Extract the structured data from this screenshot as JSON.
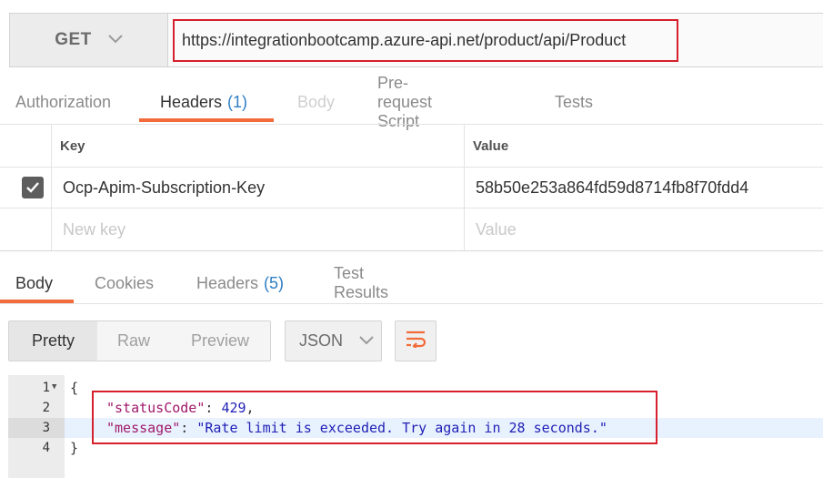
{
  "request": {
    "method": "GET",
    "url": "https://integrationbootcamp.azure-api.net/product/api/Product"
  },
  "request_tabs": [
    {
      "label": "Authorization"
    },
    {
      "label": "Headers",
      "count": "(1)"
    },
    {
      "label": "Body"
    },
    {
      "label": "Pre-request Script"
    },
    {
      "label": "Tests"
    }
  ],
  "headers_table": {
    "key_header": "Key",
    "value_header": "Value",
    "rows": [
      {
        "checked": true,
        "key": "Ocp-Apim-Subscription-Key",
        "value": "58b50e253a864fd59d8714fb8f70fdd4"
      }
    ],
    "new_key_placeholder": "New key",
    "new_value_placeholder": "Value"
  },
  "response_tabs": [
    {
      "label": "Body"
    },
    {
      "label": "Cookies"
    },
    {
      "label": "Headers",
      "count": "(5)"
    },
    {
      "label": "Test Results"
    }
  ],
  "view_modes": [
    "Pretty",
    "Raw",
    "Preview"
  ],
  "format": "JSON",
  "code_lines": [
    {
      "no": "1",
      "text": "{"
    },
    {
      "no": "2",
      "key": "\"statusCode\"",
      "sep": ": ",
      "value": "429",
      "tail": ","
    },
    {
      "no": "3",
      "key": "\"message\"",
      "sep": ": ",
      "value": "\"Rate limit is exceeded. Try again in 28 seconds.\"",
      "tail": ""
    },
    {
      "no": "4",
      "text": "}"
    }
  ],
  "colors": {
    "accent": "#f26b3a",
    "count": "#2f7ec4",
    "highlight_box": "#d6202e",
    "json_key": "#a0186a",
    "json_value": "#1f1fb6"
  }
}
